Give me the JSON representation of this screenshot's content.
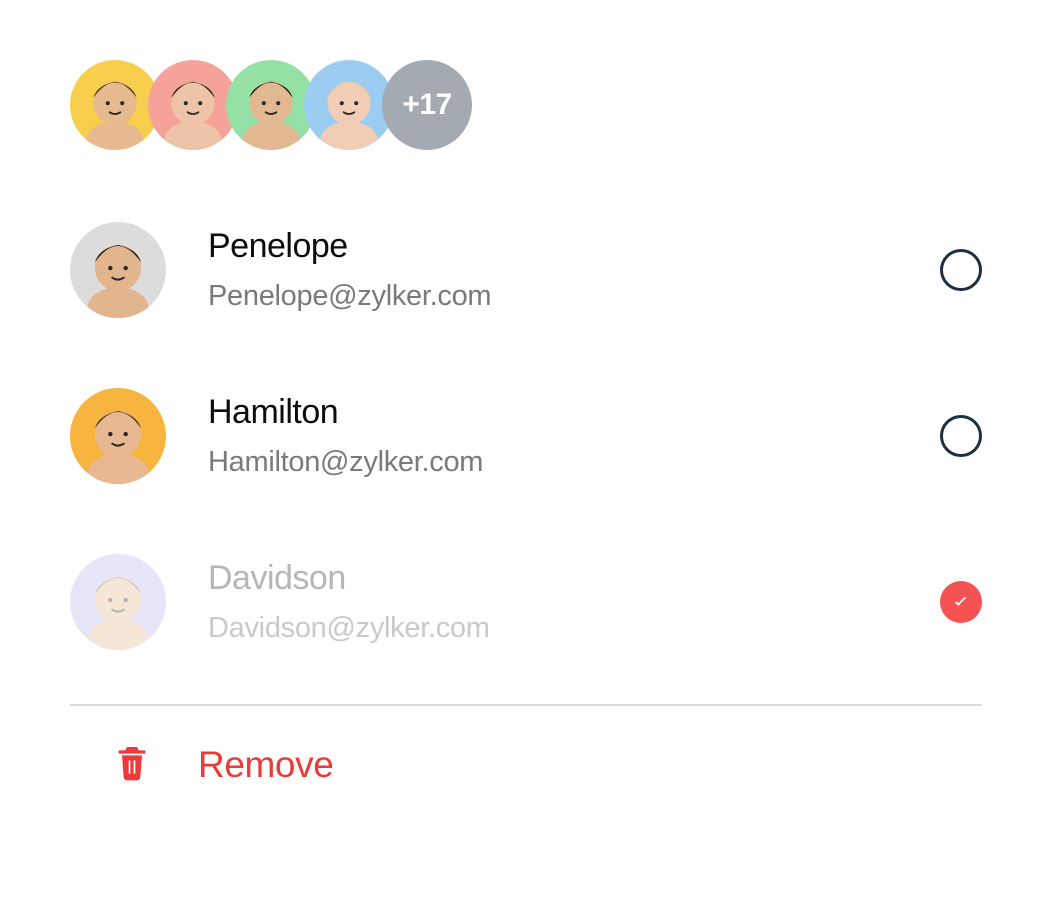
{
  "avatar_stack": {
    "avatars": [
      {
        "bg": "#f7cf4d",
        "skin": "#e6b98f",
        "hair": "#4a3420"
      },
      {
        "bg": "#f4a29a",
        "skin": "#edc4a7",
        "hair": "#2b1a12"
      },
      {
        "bg": "#94e0a5",
        "skin": "#e2b893",
        "hair": "#1f1610"
      },
      {
        "bg": "#9bcdf2",
        "skin": "#f0cdb4",
        "hair": "#e6c893"
      }
    ],
    "overflow_label": "+17"
  },
  "contacts": [
    {
      "name": "Penelope",
      "email": "Penelope@zylker.com",
      "selected": false,
      "faded": false,
      "avatar": {
        "bg": "#dcdcdc",
        "skin": "#e3b58e",
        "hair": "#2a1c12"
      }
    },
    {
      "name": "Hamilton",
      "email": "Hamilton@zylker.com",
      "selected": false,
      "faded": false,
      "avatar": {
        "bg": "#f7b53f",
        "skin": "#e8b893",
        "hair": "#5a3a22"
      }
    },
    {
      "name": "Davidson",
      "email": "Davidson@zylker.com",
      "selected": true,
      "faded": true,
      "avatar": {
        "bg": "#bdb8ef",
        "skin": "#e6b98f",
        "hair": "#7a6244"
      }
    }
  ],
  "actions": {
    "remove_label": "Remove"
  },
  "colors": {
    "accent_red": "#eb3a3a",
    "select_ring": "#1b3044",
    "text_muted": "#7a7a7a"
  }
}
